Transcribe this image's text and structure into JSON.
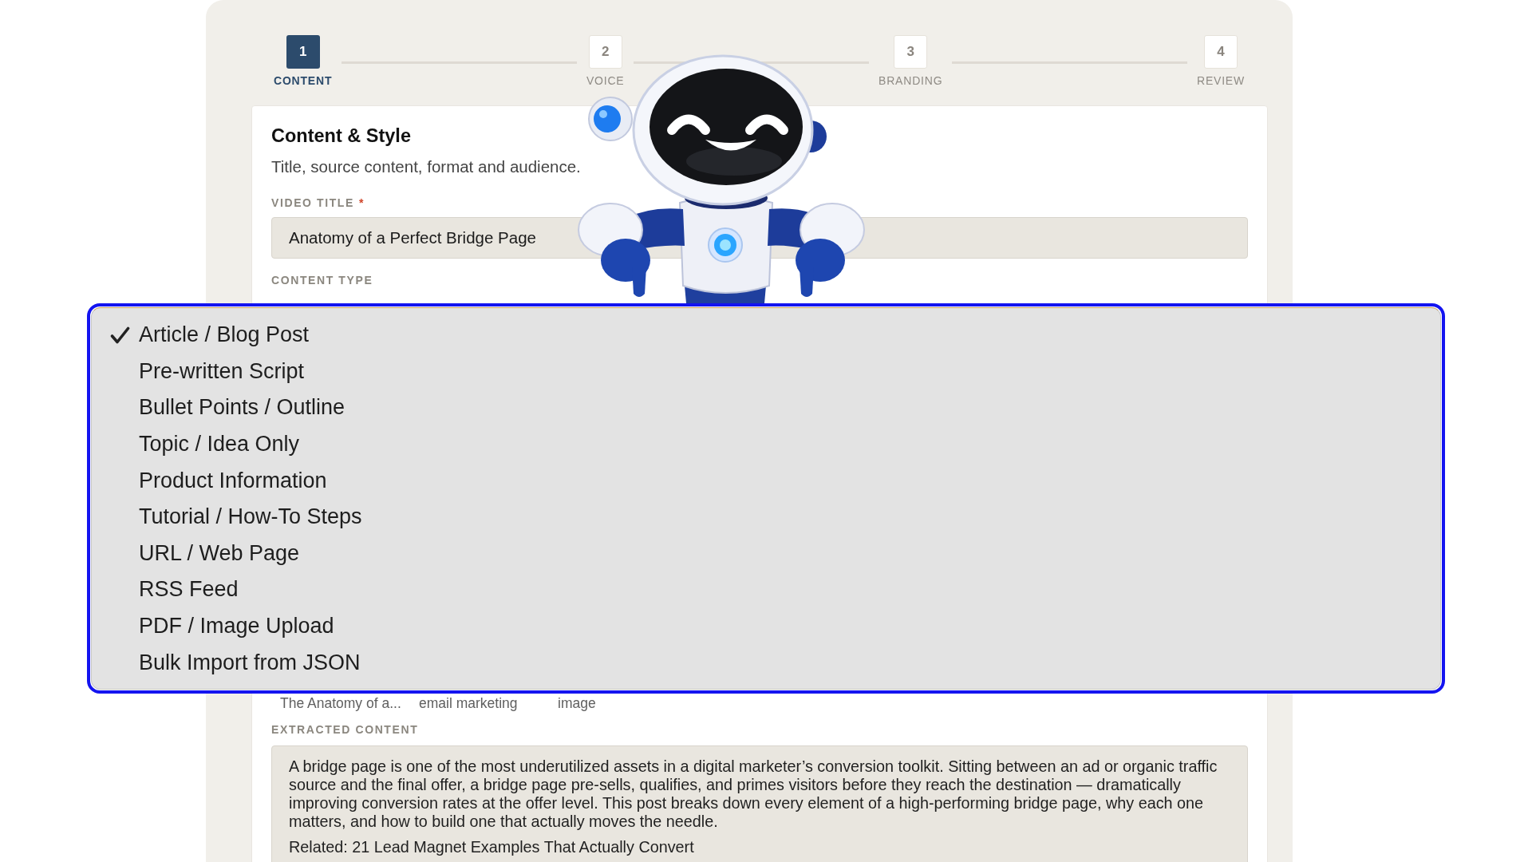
{
  "stepper": {
    "steps": [
      {
        "number": "1",
        "label": "CONTENT",
        "selected": true
      },
      {
        "number": "2",
        "label": "VOICE",
        "selected": false
      },
      {
        "number": "3",
        "label": "BRANDING",
        "selected": false
      },
      {
        "number": "4",
        "label": "REVIEW",
        "selected": false
      }
    ]
  },
  "card": {
    "title": "Content & Style",
    "subtitle": "Title, source content, format and audience.",
    "video_title": {
      "label": "VIDEO TITLE",
      "required_mark": "*",
      "value": "Anatomy of a Perfect Bridge Page"
    },
    "content_type": {
      "label": "CONTENT TYPE"
    },
    "covered_row": [
      "The Anatomy of a...",
      "email marketing",
      "image"
    ],
    "extracted_content": {
      "label": "EXTRACTED CONTENT",
      "paragraphs": [
        "A bridge page is one of the most underutilized assets in a digital marketer’s conversion toolkit. Sitting between an ad or organic traffic source and the final offer, a bridge page pre-sells, qualifies, and primes visitors before they reach the destination — dramatically improving conversion rates at the offer level. This post breaks down every element of a high-performing bridge page, why each one matters, and how to build one that actually moves the needle.",
        "Related: 21 Lead Magnet Examples That Actually Convert"
      ]
    }
  },
  "content_type_menu": {
    "items": [
      {
        "label": "Article / Blog Post",
        "selected": true
      },
      {
        "label": "Pre-written Script",
        "selected": false
      },
      {
        "label": "Bullet Points / Outline",
        "selected": false
      },
      {
        "label": "Topic / Idea Only",
        "selected": false
      },
      {
        "label": "Product Information",
        "selected": false
      },
      {
        "label": "Tutorial / How-To Steps",
        "selected": false
      },
      {
        "label": "URL / Web Page",
        "selected": false
      },
      {
        "label": "RSS Feed",
        "selected": false
      },
      {
        "label": "PDF / Image Upload",
        "selected": false
      },
      {
        "label": "Bulk Import from JSON",
        "selected": false
      }
    ]
  }
}
